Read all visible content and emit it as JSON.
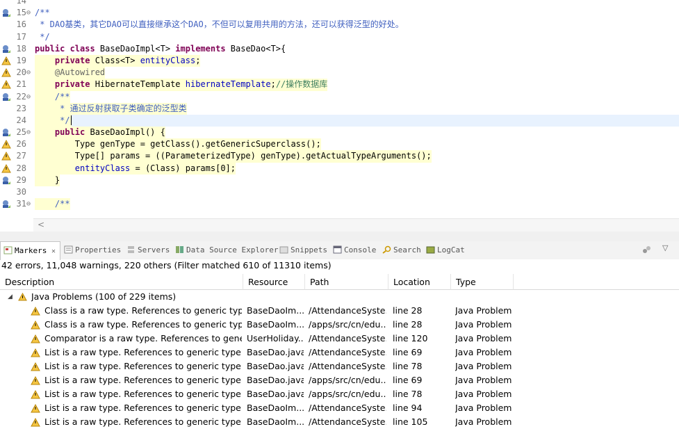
{
  "editor": {
    "lines": [
      {
        "num": "14",
        "html": ""
      },
      {
        "num": "15",
        "html": "<span class='cm'>/**</span>"
      },
      {
        "num": "16",
        "html": "<span class='cm'> * DAO基类，其它DAO可以直接继承这个DAO，不但可以复用共用的方法，还可以获得泛型的好处。</span>"
      },
      {
        "num": "17",
        "html": "<span class='cm'> */</span>"
      },
      {
        "num": "18",
        "html": "<span class='kw'>public class</span> BaseDaoImpl&lt;T&gt; <span class='kw'>implements</span> BaseDao&lt;T&gt;{"
      },
      {
        "num": "19",
        "html": "    <span class='kw'>private</span> Class&lt;T&gt; <span class='fld'>entityClass</span>;"
      },
      {
        "num": "20",
        "html": "    <span class='an'>@Autowired</span>"
      },
      {
        "num": "21",
        "html": "    <span class='kw'>private</span> HibernateTemplate <span class='fld'>hibernateTemplate</span>;<span class='lcm'>//操作数据库</span>"
      },
      {
        "num": "22",
        "html": "    <span class='cm'>/**</span>"
      },
      {
        "num": "23",
        "html": "<span class='cm'>     * 通过反射获取子类确定的泛型类</span>"
      },
      {
        "num": "24",
        "html": "<span class='cm'>     */</span>"
      },
      {
        "num": "25",
        "html": "    <span class='kw'>public</span> BaseDaoImpl() {"
      },
      {
        "num": "26",
        "html": "        Type genType = getClass().getGenericSuperclass();"
      },
      {
        "num": "27",
        "html": "        Type[] params = ((ParameterizedType) genType).getActualTypeArguments();"
      },
      {
        "num": "28",
        "html": "        <span class='fld'>entityClass</span> = (Class) params[0];"
      },
      {
        "num": "29",
        "html": "    }"
      },
      {
        "num": "30",
        "html": ""
      },
      {
        "num": "31",
        "html": "    <span class='cm'>/**</span>"
      }
    ]
  },
  "panel": {
    "tabs": [
      {
        "label": "Markers",
        "suffix": "✕",
        "icon": "markers-icon"
      },
      {
        "label": "Properties",
        "icon": "properties-icon"
      },
      {
        "label": "Servers",
        "icon": "servers-icon"
      },
      {
        "label": "Data Source Explorer",
        "icon": "data-source-icon"
      },
      {
        "label": "Snippets",
        "icon": "snippets-icon"
      },
      {
        "label": "Console",
        "icon": "console-icon"
      },
      {
        "label": "Search",
        "icon": "search-icon"
      },
      {
        "label": "LogCat",
        "icon": "logcat-icon"
      }
    ],
    "status": "42 errors, 11,048 warnings, 220 others (Filter matched 610 of 11310 items)",
    "columns": [
      "Description",
      "Resource",
      "Path",
      "Location",
      "Type"
    ],
    "group": {
      "label": "Java Problems (100 of 229 items)"
    },
    "rows": [
      {
        "description": "Class is a raw type. References to generic type C",
        "resource": "BaseDaoIm...",
        "path": "/AttendanceSyste...",
        "location": "line 28",
        "type": "Java Problem"
      },
      {
        "description": "Class is a raw type. References to generic type C",
        "resource": "BaseDaoIm...",
        "path": "/apps/src/cn/edu...",
        "location": "line 28",
        "type": "Java Problem"
      },
      {
        "description": "Comparator is a raw type. References to generic",
        "resource": "UserHoliday...",
        "path": "/AttendanceSyste...",
        "location": "line 120",
        "type": "Java Problem"
      },
      {
        "description": "List is a raw type. References to generic type List",
        "resource": "BaseDao.java",
        "path": "/AttendanceSyste...",
        "location": "line 69",
        "type": "Java Problem"
      },
      {
        "description": "List is a raw type. References to generic type List",
        "resource": "BaseDao.java",
        "path": "/AttendanceSyste...",
        "location": "line 78",
        "type": "Java Problem"
      },
      {
        "description": "List is a raw type. References to generic type List",
        "resource": "BaseDao.java",
        "path": "/apps/src/cn/edu...",
        "location": "line 69",
        "type": "Java Problem"
      },
      {
        "description": "List is a raw type. References to generic type List",
        "resource": "BaseDao.java",
        "path": "/apps/src/cn/edu...",
        "location": "line 78",
        "type": "Java Problem"
      },
      {
        "description": "List is a raw type. References to generic type List",
        "resource": "BaseDaoIm...",
        "path": "/AttendanceSyste...",
        "location": "line 94",
        "type": "Java Problem"
      },
      {
        "description": "List is a raw type. References to generic type List",
        "resource": "BaseDaoIm...",
        "path": "/AttendanceSyste...",
        "location": "line 105",
        "type": "Java Problem"
      }
    ]
  }
}
